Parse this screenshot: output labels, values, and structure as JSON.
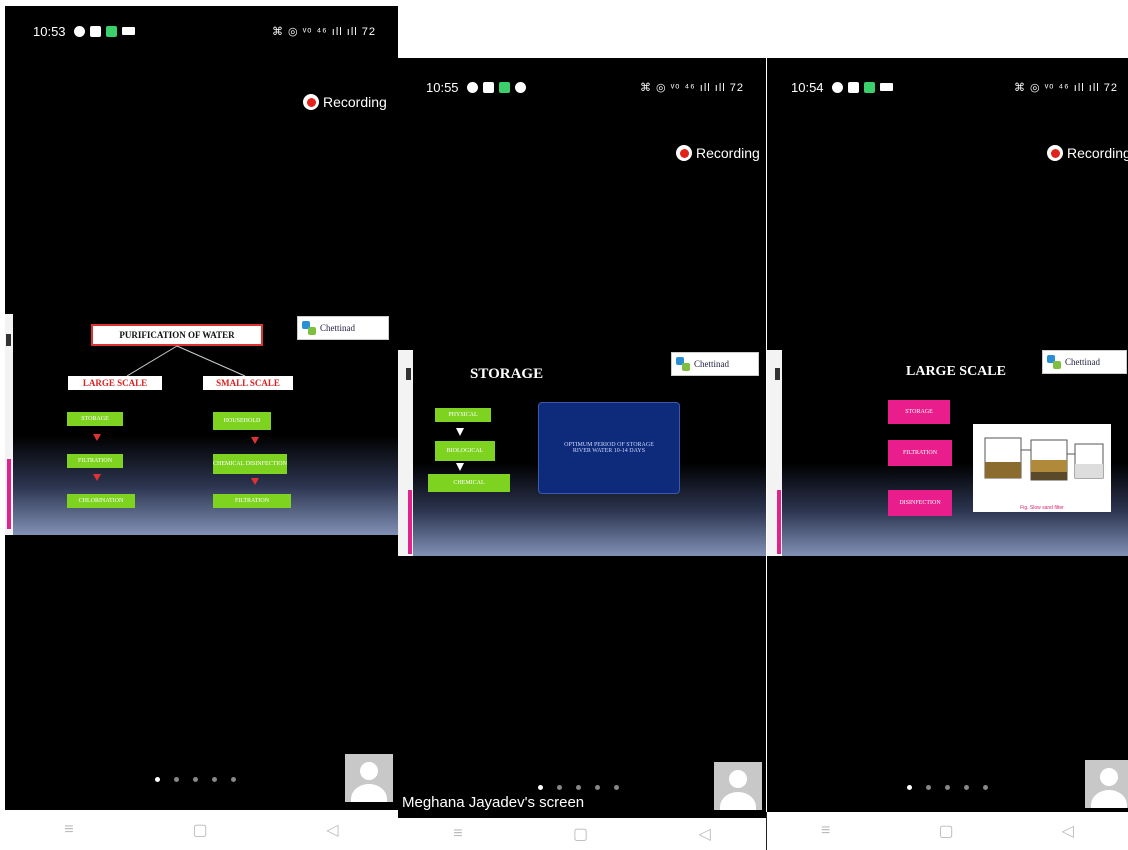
{
  "panels": [
    {
      "time": "10:53",
      "status_right": "⌘ ◎ ᵛᵒ ⁴⁶ ıll ıll 72",
      "recording": "Recording"
    },
    {
      "time": "10:55",
      "status_right": "⌘ ◎ ᵛᵒ ⁴⁶ ıll ıll 72",
      "recording": "Recording"
    },
    {
      "time": "10:54",
      "status_right": "⌘ ◎ ᵛᵒ ⁴⁶ ıll ıll 72",
      "recording": "Recording"
    }
  ],
  "logo_text": "Chettinad",
  "slide1": {
    "title": "PURIFICATION OF WATER",
    "large": "LARGE SCALE",
    "small": "SMALL SCALE",
    "large_items": [
      "STORAGE",
      "FILTRATION",
      "CHLORINATION"
    ],
    "small_items": [
      "HOUSEHOLD",
      "CHEMICAL DISINFECTION",
      "FILTRATION"
    ]
  },
  "slide2": {
    "title": "STORAGE",
    "steps": [
      "PHYSICAL",
      "BIOLOGICAL",
      "CHEMICAL"
    ],
    "scroll_text": "OPTIMUM PERIOD OF STORAGE RIVER WATER 10-14 DAYS"
  },
  "slide3": {
    "title": "LARGE SCALE",
    "steps": [
      "STORAGE",
      "FILTRATION",
      "DISINFECTION"
    ],
    "diagram_caption": "Fig. Slow sand filter"
  },
  "screen_label": "Meghana Jayadev's screen",
  "nav": {
    "menu": "≡",
    "home": "▢",
    "back": "◁"
  }
}
